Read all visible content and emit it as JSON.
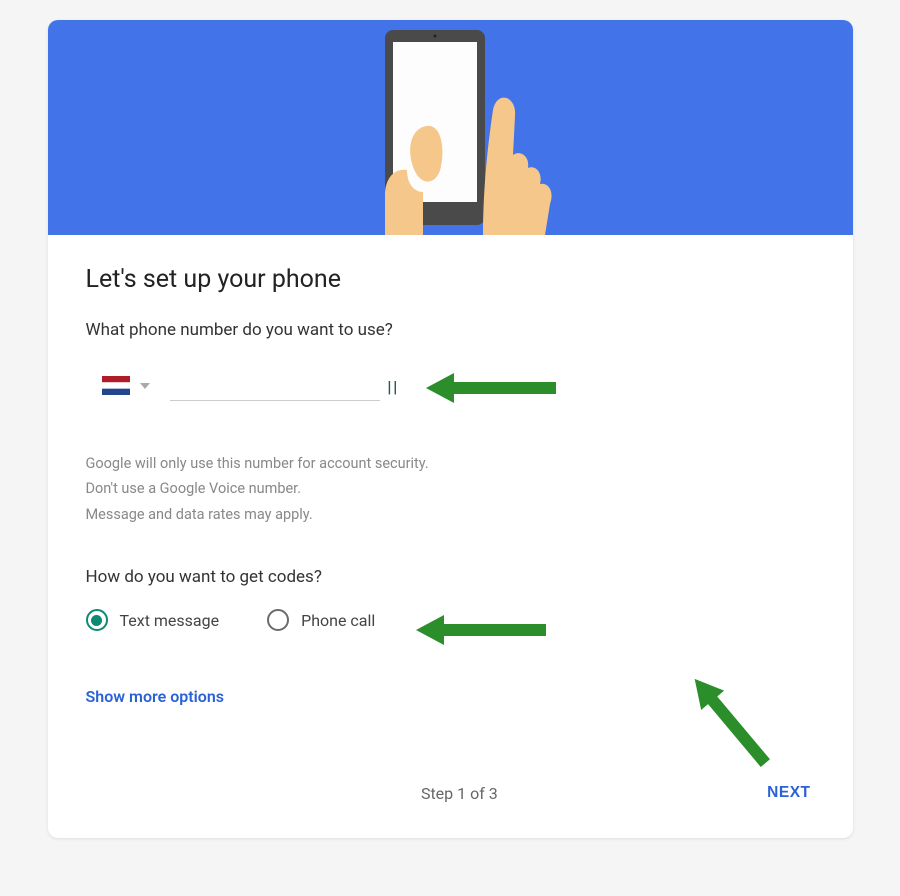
{
  "heading": "Let's set up your phone",
  "phone_prompt": "What phone number do you want to use?",
  "country": {
    "flag_name": "netherlands-flag-icon",
    "selected": "NL"
  },
  "phone_input": {
    "value": "",
    "placeholder": ""
  },
  "helper_lines": {
    "l1": "Google will only use this number for account security.",
    "l2": "Don't use a Google Voice number.",
    "l3": "Message and data rates may apply."
  },
  "codes_prompt": "How do you want to get codes?",
  "radio": {
    "text_message": "Text message",
    "phone_call": "Phone call",
    "selected": "text_message"
  },
  "show_more": "Show more options",
  "step_label": "Step 1 of 3",
  "next_label": "NEXT",
  "colors": {
    "hero": "#4273e8",
    "accent": "#2a62d6",
    "radio_selected": "#0c8a72",
    "arrow": "#2b8e2b"
  }
}
